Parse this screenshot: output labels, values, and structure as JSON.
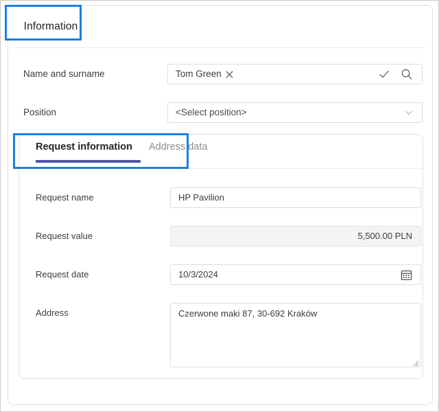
{
  "header": {
    "tab_label": "Information"
  },
  "form": {
    "name_row": {
      "label": "Name and surname",
      "value": "Tom Green",
      "clear_icon": "close-x-icon",
      "confirm_icon": "checkmark-icon",
      "search_icon": "search-icon"
    },
    "position_row": {
      "label": "Position",
      "placeholder": "<Select position>",
      "chevron_icon": "chevron-down-icon"
    }
  },
  "inner_panel": {
    "tabs": [
      {
        "label": "Request information",
        "active": true
      },
      {
        "label": "Address data",
        "active": false
      }
    ],
    "fields": {
      "request_name": {
        "label": "Request name",
        "value": "HP Pavilion"
      },
      "request_value": {
        "label": "Request value",
        "value": "5,500.00  PLN",
        "readonly": true
      },
      "request_date": {
        "label": "Request date",
        "value": "10/3/2024",
        "calendar_icon": "calendar-icon"
      },
      "address": {
        "label": "Address",
        "value": "Czerwone maki 87, 30-692 Kraków",
        "resize_icon": "resize-grip-icon"
      }
    }
  },
  "colors": {
    "annotation": "#1a7fe0",
    "active_tab_underline": "#4f52b2",
    "border": "#dcdcdc",
    "readonly_bg": "#f4f4f4",
    "text": "#3c3c3c",
    "muted_text": "#8d8d8d"
  }
}
